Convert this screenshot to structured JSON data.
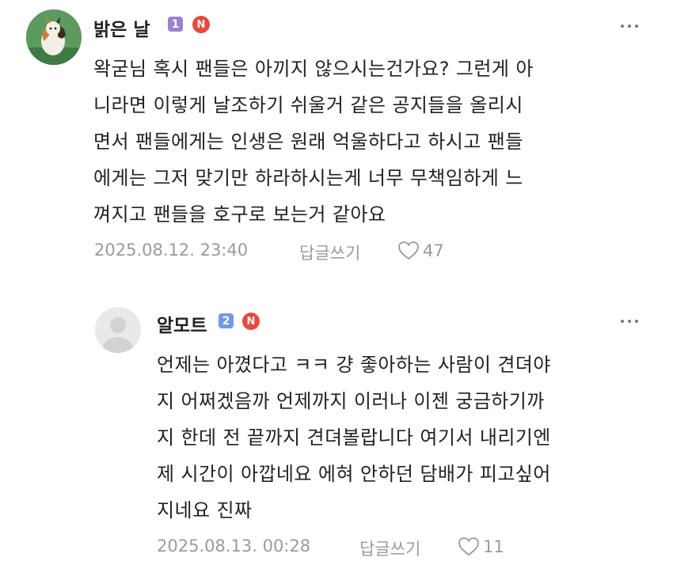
{
  "comments": [
    {
      "author": "밝은 날",
      "grade": "1",
      "badge": "N",
      "lines": [
        "왁굳님 혹시 팬들은 아끼지 않으시는건가요? 그런게 아",
        "니라면 이렇게 날조하기 쉬울거 같은 공지들을 올리시",
        "면서 팬들에게는 인생은 원래 억울하다고 하시고 팬들",
        "에게는 그저 맞기만 하라하시는게 너무 무책임하게 느",
        "껴지고 팬들을 호구로 보는거 같아요"
      ],
      "date": "2025.08.12. 23:40",
      "reply_label": "답글쓰기",
      "likes": "47"
    },
    {
      "author": "알모트",
      "grade": "2",
      "badge": "N",
      "lines": [
        "언제는 아꼈다고 ㅋㅋ 걍 좋아하는 사람이 견뎌야",
        "지 어쩌겠음까 언제까지 이러나 이젠 궁금하기까",
        "지 한데 전 끝까지 견뎌볼랍니다 여기서 내리기엔",
        "제 시간이 아깝네요 에혀 안하던 담배가 피고싶어",
        "지네요 진짜"
      ],
      "date": "2025.08.13. 00:28",
      "reply_label": "답글쓰기",
      "likes": "11"
    }
  ]
}
